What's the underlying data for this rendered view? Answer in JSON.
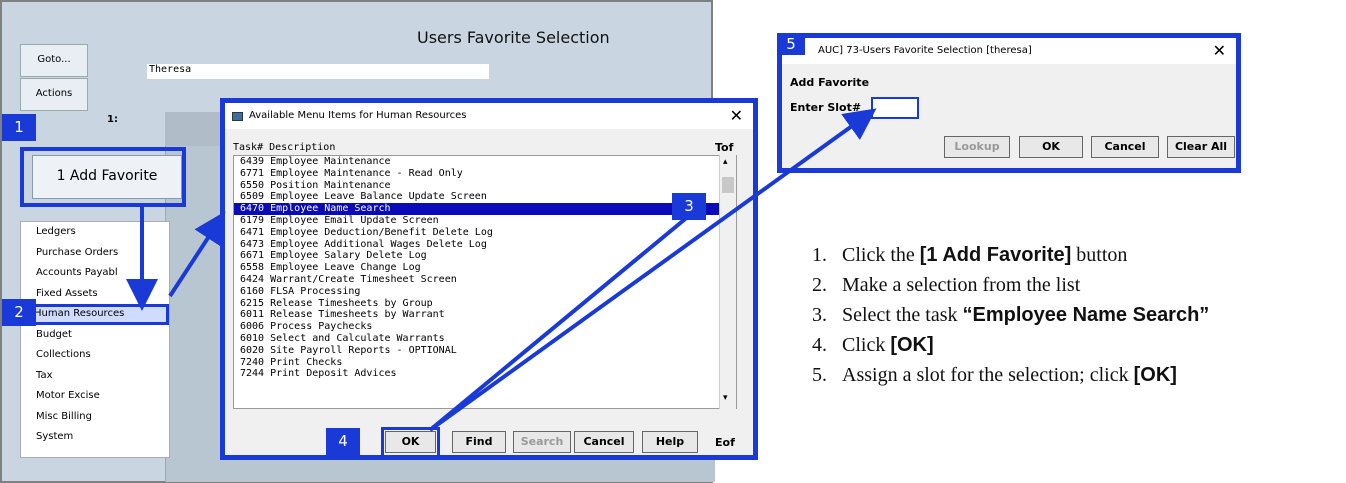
{
  "app": {
    "title": "Users Favorite Selection",
    "goto_label": "Goto...",
    "actions_label": "Actions",
    "user_name": "Theresa",
    "slot1_label": "1:",
    "add_favorite_label": "1 Add Favorite",
    "categories": [
      {
        "label": "Ledgers"
      },
      {
        "label": "Purchase Orders"
      },
      {
        "label": "Accounts Payabl"
      },
      {
        "label": "Fixed Assets"
      },
      {
        "label": "Human Resources"
      },
      {
        "label": "Budget"
      },
      {
        "label": "Collections"
      },
      {
        "label": "Tax"
      },
      {
        "label": "Motor Excise"
      },
      {
        "label": "Misc Billing"
      },
      {
        "label": "System"
      }
    ]
  },
  "menu_dialog": {
    "title": "Available Menu Items for Human Resources",
    "col_header": "Task# Description",
    "tof_label": "Tof",
    "eof_label": "Eof",
    "items": [
      "6439 Employee Maintenance",
      "6771 Employee Maintenance - Read Only",
      "6550 Position Maintenance",
      "6509 Employee Leave Balance Update Screen",
      "6470 Employee Name Search",
      "6179 Employee Email Update Screen",
      "6471 Employee Deduction/Benefit Delete Log",
      "6473 Employee Additional Wages Delete Log",
      "6671 Employee Salary Delete Log",
      "6558 Employee Leave Change Log",
      "6424 Warrant/Create Timesheet Screen",
      "6160 FLSA Processing",
      "6215 Release Timesheets by Group",
      "6011 Release Timesheets by Warrant",
      "6006 Process Paychecks",
      "6010 Select and Calculate Warrants",
      "6020 Site Payroll Reports - OPTIONAL",
      "7240 Print Checks",
      "7244 Print Deposit Advices"
    ],
    "buttons": {
      "ok": "OK",
      "find": "Find",
      "search": "Search",
      "cancel": "Cancel",
      "help": "Help"
    }
  },
  "favorite_dialog": {
    "title": "AUC] 73-Users Favorite Selection [theresa]",
    "heading": "Add Favorite",
    "slot_label": "Enter Slot#",
    "slot_value": "",
    "buttons": {
      "lookup": "Lookup",
      "ok": "OK",
      "cancel": "Cancel",
      "clear_all": "Clear All"
    }
  },
  "callouts": {
    "n1": "1",
    "n2": "2",
    "n3": "3",
    "n4": "4",
    "n5": "5"
  },
  "instructions": {
    "s1_pre": "Click the ",
    "s1_bold": "[1 Add Favorite]",
    "s1_post": " button",
    "s2": "Make a selection from the list",
    "s3_pre": "Select the task ",
    "s3_bold": "“Employee Name Search”",
    "s4_pre": "Click ",
    "s4_bold": "[OK]",
    "s5_pre": "Assign a slot for the selection; click ",
    "s5_bold": "[OK]"
  },
  "colors": {
    "callout_blue": "#1a3ad8",
    "selection_blue": "#0a0ab8",
    "app_bg": "#c9d6e2"
  }
}
